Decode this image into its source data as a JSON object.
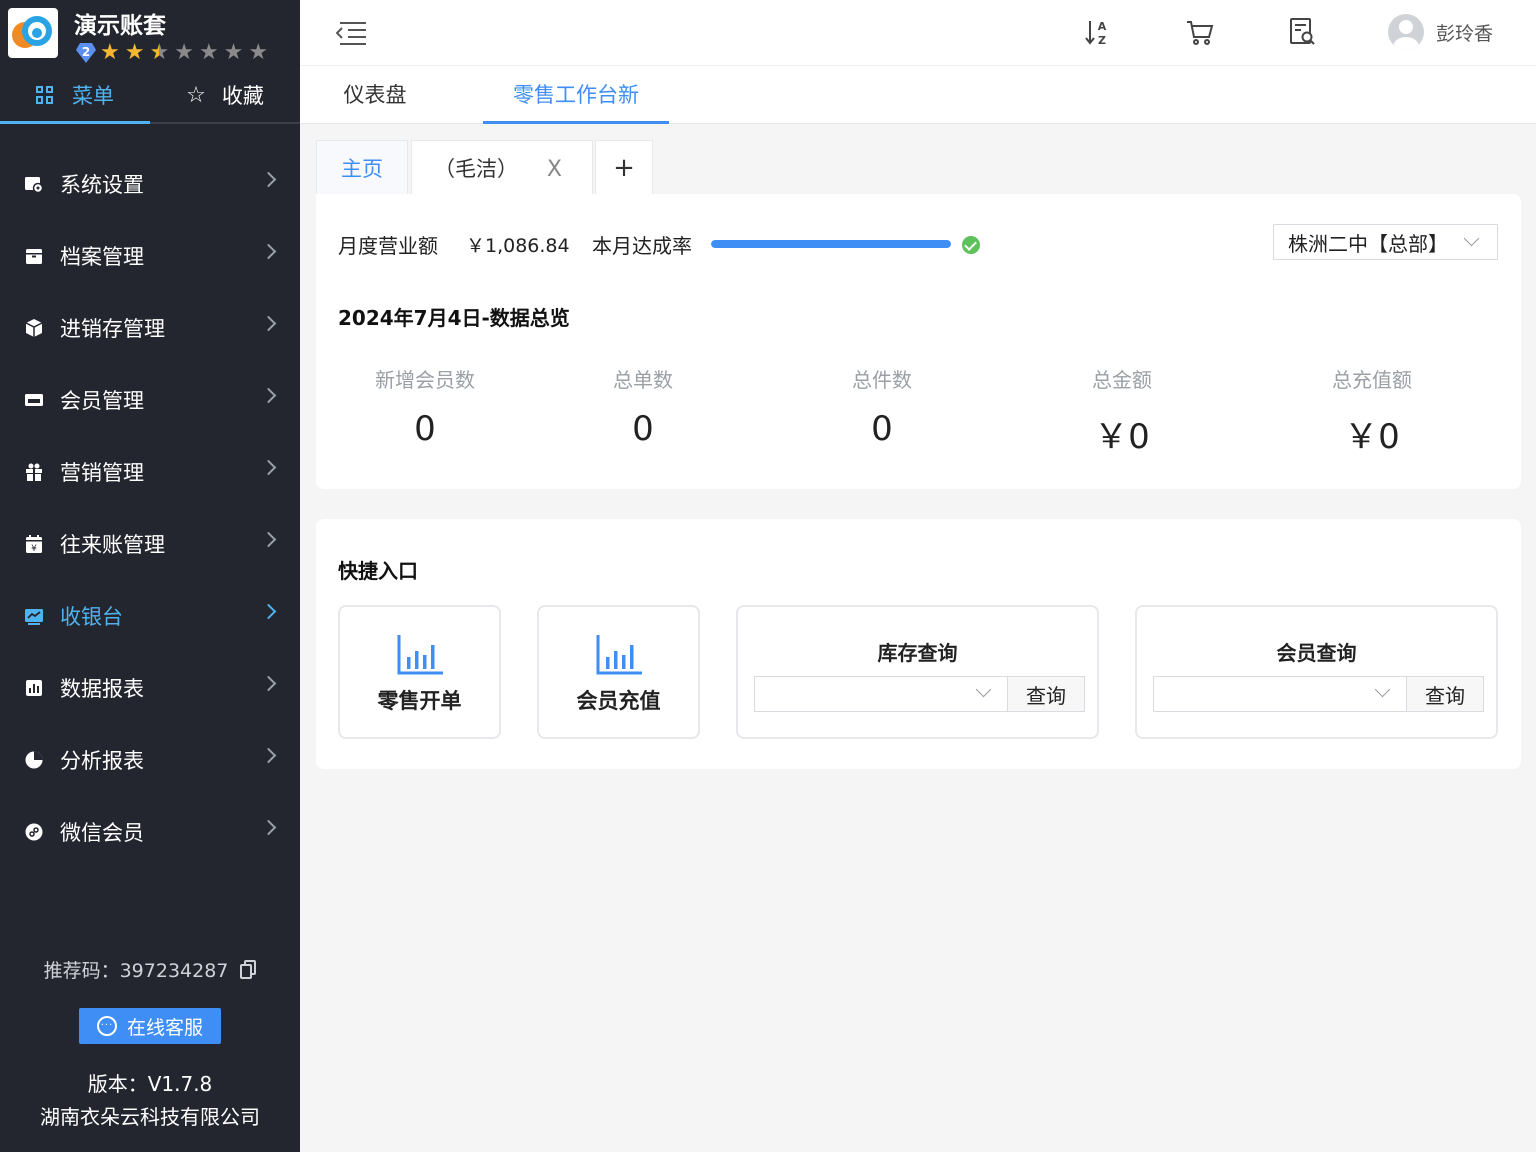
{
  "brand": {
    "title": "演示账套",
    "level": "2",
    "stars_total": 7,
    "stars_rating": 2.5
  },
  "side_tabs": {
    "menu": "菜单",
    "favorites": "收藏"
  },
  "nav": [
    {
      "label": "系统设置",
      "icon": "settings-icon"
    },
    {
      "label": "档案管理",
      "icon": "archive-icon"
    },
    {
      "label": "进销存管理",
      "icon": "box-icon"
    },
    {
      "label": "会员管理",
      "icon": "vip-card-icon"
    },
    {
      "label": "营销管理",
      "icon": "gift-icon"
    },
    {
      "label": "往来账管理",
      "icon": "calendar-yen-icon"
    },
    {
      "label": "收银台",
      "icon": "chart-monitor-icon",
      "active": true
    },
    {
      "label": "数据报表",
      "icon": "bar-report-icon"
    },
    {
      "label": "分析报表",
      "icon": "pie-chart-icon"
    },
    {
      "label": "微信会员",
      "icon": "wechat-icon"
    }
  ],
  "referral": {
    "label": "推荐码：397234287"
  },
  "service": {
    "label": "在线客服"
  },
  "footer": {
    "version": "版本：V1.7.8",
    "company": "湖南衣朵云科技有限公司"
  },
  "topbar": {
    "user": "彭玲香"
  },
  "page_tabs": [
    {
      "label": "仪表盘"
    },
    {
      "label": "零售工作台新",
      "active": true
    }
  ],
  "inner_tabs": {
    "home": "主页",
    "second": "（毛洁）",
    "close": "X",
    "add": "+"
  },
  "summary": {
    "revenue_label": "月度营业额",
    "revenue_value": "￥1,086.84",
    "rate_label": "本月达成率",
    "rate_percent": 100,
    "store": "株洲二中【总部】",
    "overview_title": "2024年7月4日-数据总览",
    "stats": [
      {
        "label": "新增会员数",
        "value": "0"
      },
      {
        "label": "总单数",
        "value": "0"
      },
      {
        "label": "总件数",
        "value": "0"
      },
      {
        "label": "总金额",
        "value": "￥0"
      },
      {
        "label": "总充值额",
        "value": "￥0"
      }
    ]
  },
  "quick": {
    "title": "快捷入口",
    "retail_order": "零售开单",
    "member_recharge": "会员充值",
    "stock_query": "库存查询",
    "member_query": "会员查询",
    "query_button": "查询"
  },
  "colors": {
    "accent": "#3f8ef5",
    "sidebar_bg": "#23262e",
    "sidebar_active": "#4fb3f0",
    "success": "#5ec25a"
  }
}
